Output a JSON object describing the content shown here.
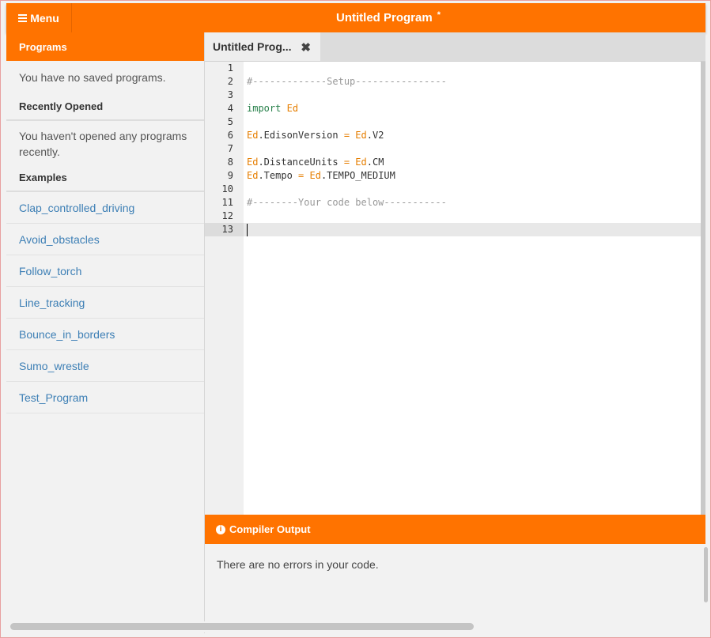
{
  "header": {
    "menu_label": "Menu",
    "title": "Untitled Program",
    "unsaved_marker": "*"
  },
  "sidebar": {
    "programs_title": "Programs",
    "no_saved": "You have no saved programs.",
    "recent_title": "Recently Opened",
    "no_recent": "You haven't opened any programs recently.",
    "examples_title": "Examples",
    "examples": [
      "Clap_controlled_driving",
      "Avoid_obstacles",
      "Follow_torch",
      "Line_tracking",
      "Bounce_in_borders",
      "Sumo_wrestle",
      "Test_Program"
    ]
  },
  "editor": {
    "tab_label": "Untitled Prog...",
    "tab_close": "✖",
    "line_numbers": [
      "1",
      "2",
      "3",
      "4",
      "5",
      "6",
      "7",
      "8",
      "9",
      "10",
      "11",
      "12",
      "13"
    ],
    "lines": [
      "",
      "#-------------Setup----------------",
      "",
      "import Ed",
      "",
      "Ed.EdisonVersion = Ed.V2",
      "",
      "Ed.DistanceUnits = Ed.CM",
      "Ed.Tempo = Ed.TEMPO_MEDIUM",
      "",
      "#--------Your code below-----------",
      "",
      ""
    ]
  },
  "output": {
    "title": "Compiler Output",
    "message": "There are no errors in your code."
  },
  "colors": {
    "accent": "#ff7300",
    "link": "#3d7fb5"
  }
}
